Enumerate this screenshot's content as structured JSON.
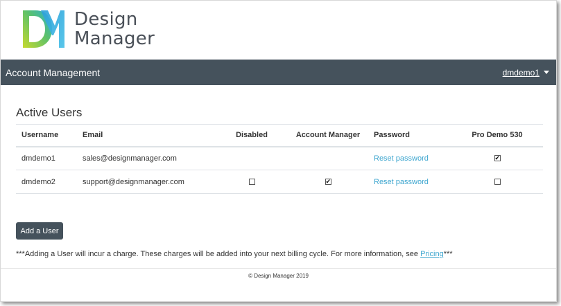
{
  "brand": {
    "line1": "Design",
    "line2": "Manager"
  },
  "navbar": {
    "title": "Account Management",
    "user": "dmdemo1"
  },
  "section": {
    "title": "Active Users"
  },
  "table": {
    "headers": {
      "username": "Username",
      "email": "Email",
      "disabled": "Disabled",
      "account_manager": "Account Manager",
      "password": "Password",
      "pro_demo": "Pro Demo 530"
    },
    "rows": [
      {
        "username": "dmdemo1",
        "email": "sales@designmanager.com",
        "disabled": null,
        "account_manager": null,
        "password_link": "Reset password",
        "pro_demo": true
      },
      {
        "username": "dmdemo2",
        "email": "support@designmanager.com",
        "disabled": false,
        "account_manager": true,
        "password_link": "Reset password",
        "pro_demo": false
      }
    ]
  },
  "add_user_button": "Add a User",
  "note": {
    "text": "***Adding a User will incur a charge. These charges will be added into your next billing cycle. For more information, see ",
    "link": "Pricing",
    "suffix": "***"
  },
  "footer": "© Design Manager 2019",
  "colors": {
    "navbar": "#45525c",
    "link": "#3ea6cf",
    "logo_green": "#8cc63f",
    "logo_blue": "#29abe2"
  }
}
